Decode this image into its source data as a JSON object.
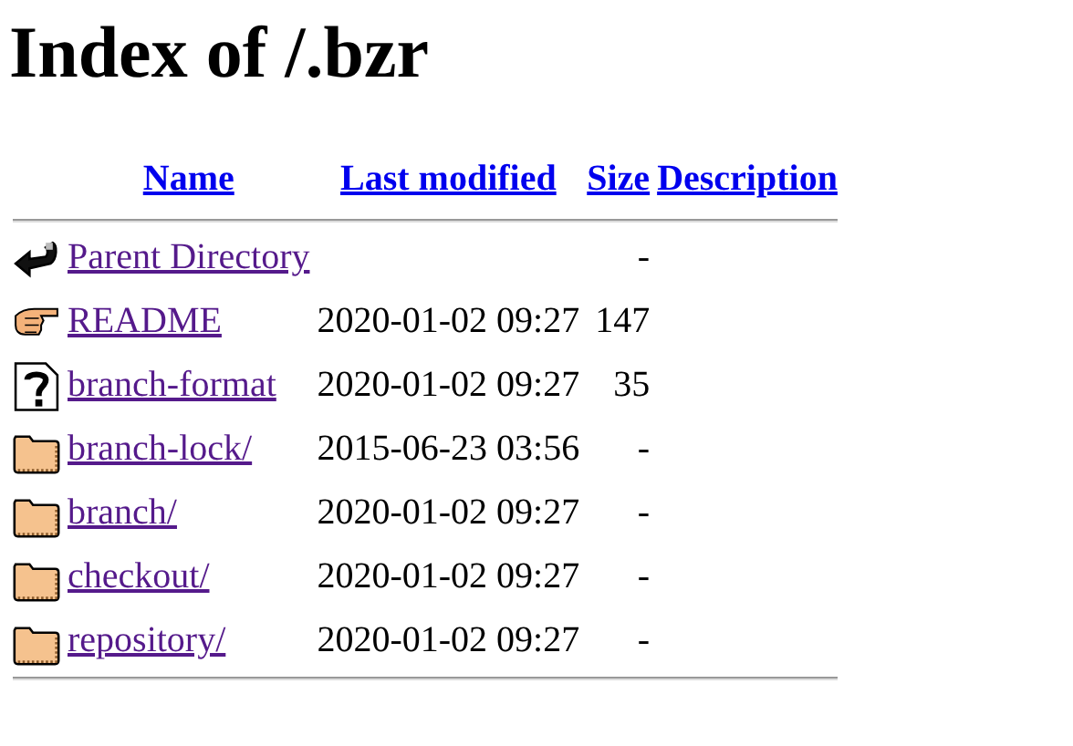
{
  "title": "Index of /.bzr",
  "columns": [
    "Name",
    "Last modified",
    "Size",
    "Description"
  ],
  "rows": [
    {
      "kind": "back",
      "name": "Parent Directory",
      "modified": "",
      "size": "-"
    },
    {
      "kind": "text",
      "name": "README",
      "modified": "2020-01-02 09:27",
      "size": "147"
    },
    {
      "kind": "unknown",
      "name": "branch-format",
      "modified": "2020-01-02 09:27",
      "size": "35"
    },
    {
      "kind": "folder",
      "name": "branch-lock/",
      "modified": "2015-06-23 03:56",
      "size": "-"
    },
    {
      "kind": "folder",
      "name": "branch/",
      "modified": "2020-01-02 09:27",
      "size": "-"
    },
    {
      "kind": "folder",
      "name": "checkout/",
      "modified": "2020-01-02 09:27",
      "size": "-"
    },
    {
      "kind": "folder",
      "name": "repository/",
      "modified": "2020-01-02 09:27",
      "size": "-"
    }
  ]
}
